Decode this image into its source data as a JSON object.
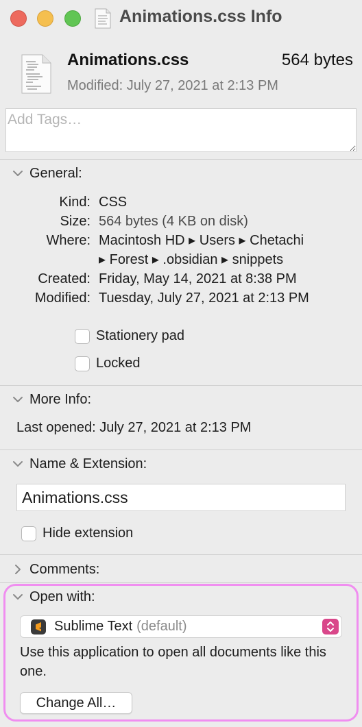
{
  "window": {
    "title": "Animations.css Info"
  },
  "header": {
    "file_name": "Animations.css",
    "file_size": "564 bytes",
    "modified": "Modified: July 27, 2021 at 2:13 PM"
  },
  "tags": {
    "placeholder": "Add Tags…"
  },
  "general": {
    "label": "General:",
    "rows": [
      {
        "key": "Kind:",
        "value": "CSS"
      },
      {
        "key": "Size:",
        "value": "564 bytes (4 KB on disk)"
      },
      {
        "key": "Where:",
        "value": "Macintosh HD ▸ Users ▸ Chetachi",
        "value_cont": "▸ Forest ▸ .obsidian ▸ snippets"
      },
      {
        "key": "Created:",
        "value": "Friday, May 14, 2021 at 8:38 PM"
      },
      {
        "key": "Modified:",
        "value": "Tuesday, July 27, 2021 at 2:13 PM"
      }
    ],
    "stationery_label": "Stationery pad",
    "locked_label": "Locked"
  },
  "more_info": {
    "label": "More Info:",
    "last_opened": "Last opened:  July 27, 2021 at 2:13 PM"
  },
  "name_ext": {
    "label": "Name & Extension:",
    "value": "Animations.css",
    "hide_ext_label": "Hide extension"
  },
  "comments": {
    "label": "Comments:"
  },
  "open_with": {
    "label": "Open with:",
    "app_name": "Sublime Text",
    "app_default": "(default)",
    "description": "Use this application to open all documents like this one.",
    "change_all_label": "Change All…"
  },
  "colors": {
    "highlight_border": "#f08ef0",
    "popup_arrow": "#d9478a",
    "app_icon_bg": "#3a3a3a",
    "app_icon_glyph": "#f39a1c"
  },
  "icons": [
    "document-icon",
    "chevron-down-icon",
    "chevron-right-icon",
    "sublime-text-icon",
    "popup-arrows-icon"
  ]
}
